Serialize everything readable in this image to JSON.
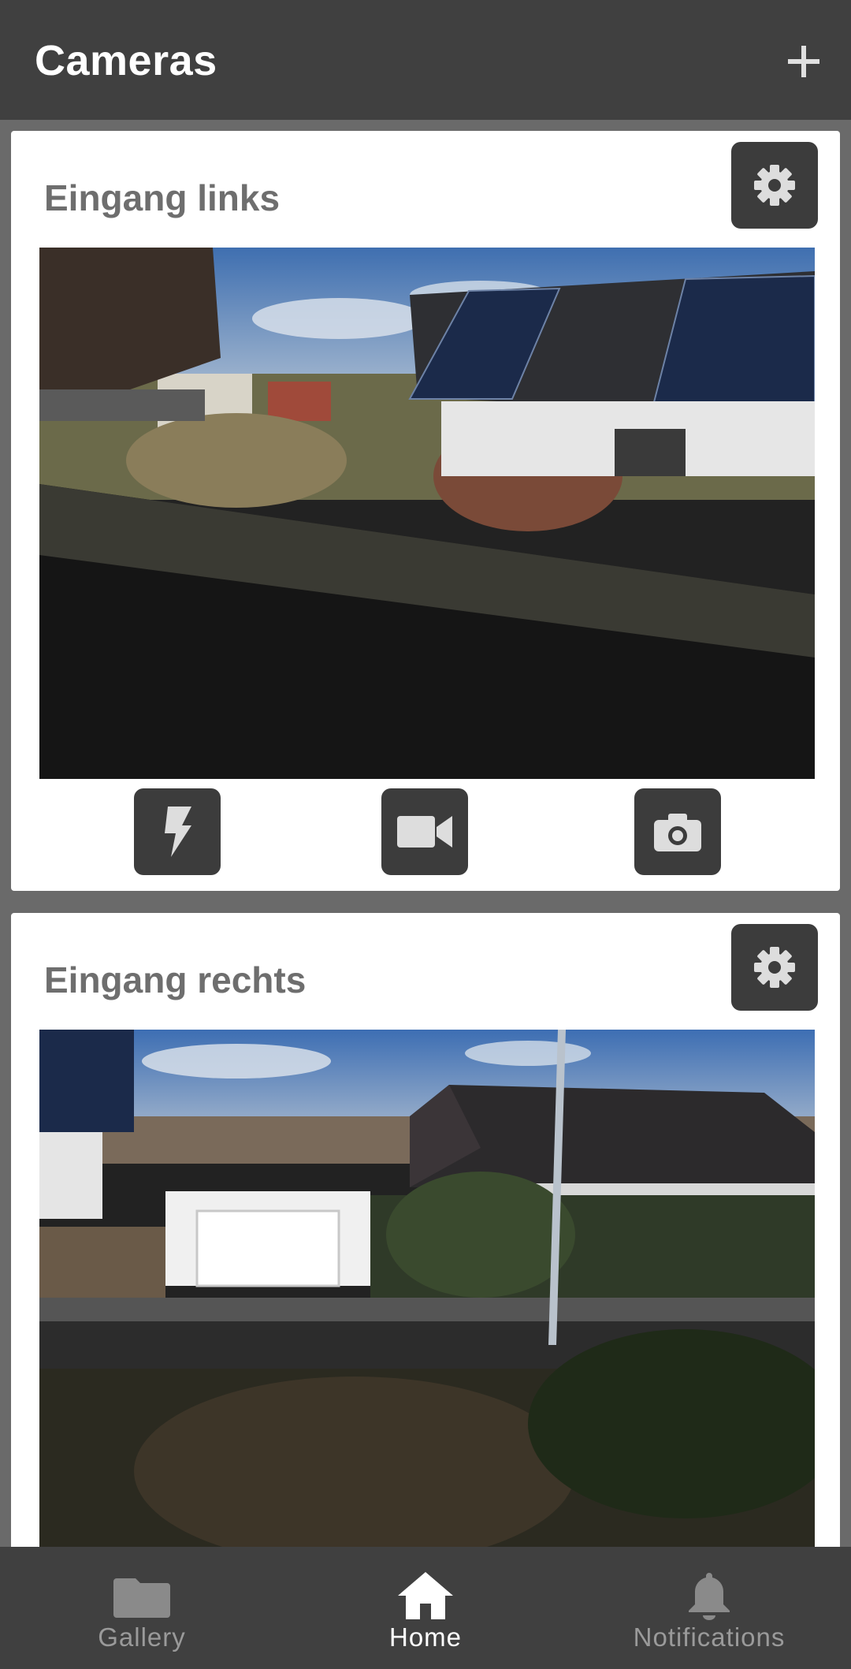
{
  "app_bar": {
    "title": "Cameras",
    "add_icon": "plus-icon"
  },
  "cameras": [
    {
      "name": "Eingang links",
      "settings_icon": "gear-icon",
      "actions": [
        {
          "icon": "flash-icon"
        },
        {
          "icon": "video-camera-icon"
        },
        {
          "icon": "photo-camera-icon"
        }
      ]
    },
    {
      "name": "Eingang rechts",
      "settings_icon": "gear-icon"
    }
  ],
  "bottom_nav": {
    "items": [
      {
        "label": "Gallery",
        "icon": "folder-icon",
        "active": false
      },
      {
        "label": "Home",
        "icon": "home-icon",
        "active": true
      },
      {
        "label": "Notifications",
        "icon": "bell-icon",
        "active": false
      }
    ]
  },
  "colors": {
    "app_bar": "#404040",
    "button": "#3c3c3c",
    "active_label": "#ffffff",
    "inactive_label": "#9a9a9a"
  }
}
